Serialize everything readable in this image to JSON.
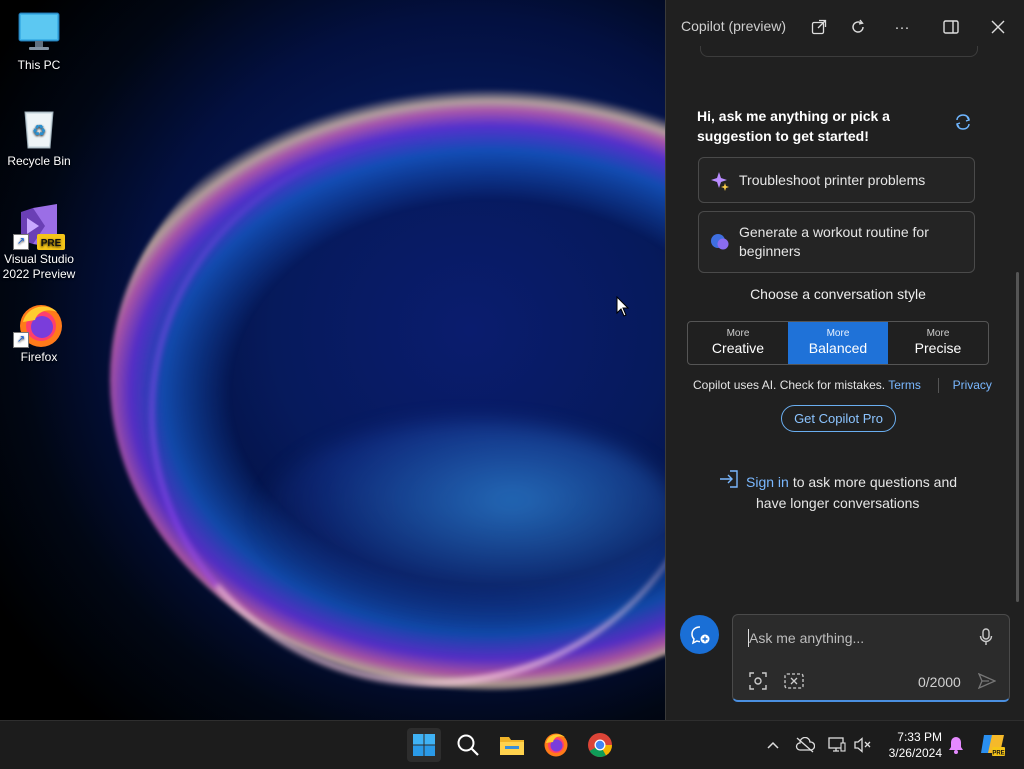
{
  "desktop": {
    "icons": [
      {
        "label": "This PC",
        "icon": "monitor-icon"
      },
      {
        "label": "Recycle Bin",
        "icon": "recycle-bin-icon"
      },
      {
        "label_line1": "Visual Studio",
        "label_line2": "2022 Preview",
        "badge": "PRE",
        "icon": "visual-studio-icon"
      },
      {
        "label": "Firefox",
        "icon": "firefox-icon"
      }
    ]
  },
  "copilot": {
    "title": "Copilot (preview)",
    "header_icons": [
      "open-external-icon",
      "refresh-icon",
      "more-icon",
      "split-view-icon",
      "close-icon"
    ],
    "greeting": "Hi, ask me anything or pick a suggestion to get started!",
    "suggestions": [
      {
        "text": "Troubleshoot printer problems",
        "icon": "sparkle-icon"
      },
      {
        "text_line1": "Generate a workout routine for",
        "text_line2": "beginners",
        "icon": "chat-bubbles-icon"
      }
    ],
    "style_title": "Choose a conversation style",
    "styles": [
      {
        "small": "More",
        "label": "Creative",
        "active": false
      },
      {
        "small": "More",
        "label": "Balanced",
        "active": true
      },
      {
        "small": "More",
        "label": "Precise",
        "active": false
      }
    ],
    "disclaimer": "Copilot uses AI. Check for mistakes.",
    "terms_link": "Terms",
    "privacy_link": "Privacy",
    "pro_button": "Get Copilot Pro",
    "signin_link": "Sign in",
    "signin_text1": "to ask more questions and",
    "signin_text2": "have longer conversations",
    "input": {
      "placeholder": "Ask me anything...",
      "counter": "0/2000"
    },
    "colors": {
      "accent": "#1f72d8",
      "link": "#7ab8ff"
    }
  },
  "taskbar": {
    "apps": [
      "start-icon",
      "search-icon",
      "file-explorer-icon",
      "firefox-icon",
      "chrome-icon"
    ],
    "tray_icons": [
      "chevron-up-icon",
      "network-off-icon",
      "display-icon",
      "volume-muted-icon",
      "notification-bell-icon",
      "copilot-pre-icon"
    ],
    "time": "7:33 PM",
    "date": "3/26/2024"
  }
}
